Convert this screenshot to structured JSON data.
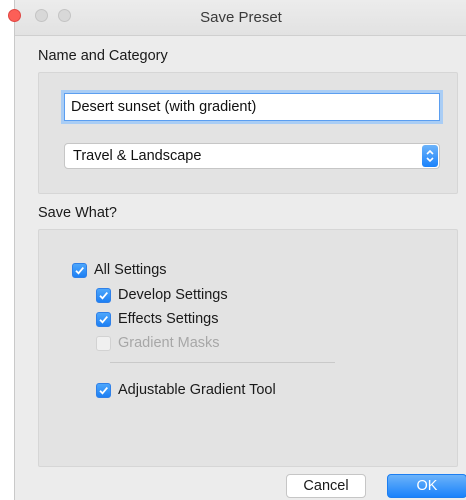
{
  "window": {
    "title": "Save Preset"
  },
  "name_section": {
    "label": "Name and Category",
    "name_value": "Desert sunset (with gradient)",
    "category_value": "Travel & Landscape"
  },
  "save_section": {
    "label": "Save What?",
    "items": [
      {
        "label": "All Settings",
        "checked": true,
        "enabled": true
      },
      {
        "label": "Develop Settings",
        "checked": true,
        "enabled": true
      },
      {
        "label": "Effects Settings",
        "checked": true,
        "enabled": true
      },
      {
        "label": "Gradient Masks",
        "checked": false,
        "enabled": false
      },
      {
        "label": "Adjustable Gradient Tool",
        "checked": true,
        "enabled": true
      }
    ]
  },
  "buttons": {
    "cancel": "Cancel",
    "ok": "OK"
  },
  "colors": {
    "accent": "#1a82fb",
    "window_bg": "#ececec",
    "panel_bg": "#e3e3e3",
    "close_button": "#fc5f57"
  },
  "icons": {
    "checkmark": "checkmark-icon",
    "stepper": "up-down-chevron-icon"
  }
}
